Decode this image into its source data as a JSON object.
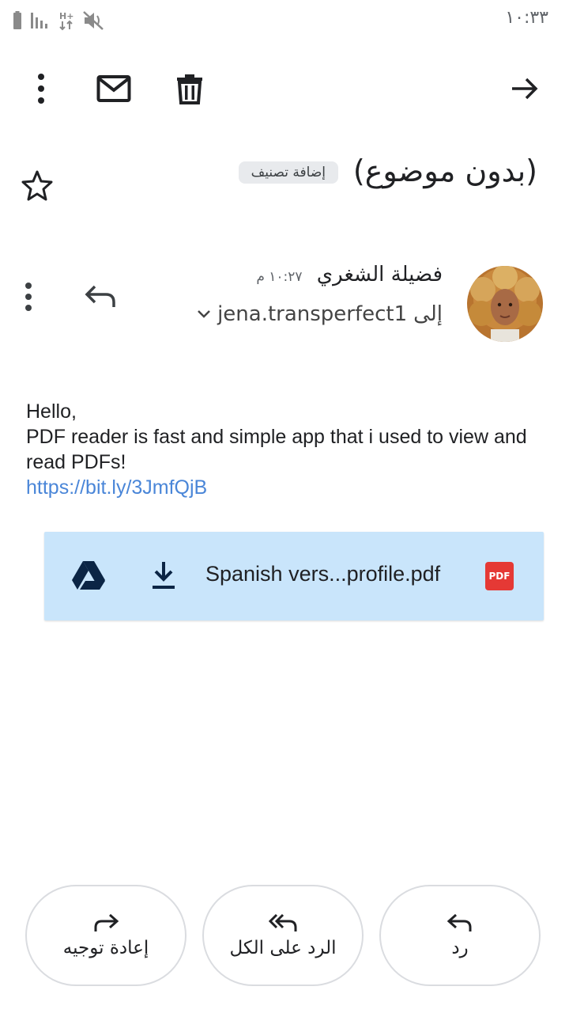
{
  "status_bar": {
    "time": "١٠:٣٣"
  },
  "toolbar": {
    "icons": [
      "more-vert-icon",
      "mail-icon",
      "delete-icon",
      "forward-arrow-icon"
    ]
  },
  "subject": {
    "text": "(بدون موضوع)",
    "label_chip": "إضافة تصنيف"
  },
  "sender": {
    "name": "فضيلة الشغري",
    "time": "١٠:٢٧ م",
    "recipient_prefix": "إلى",
    "recipient": "jena.transperfect1"
  },
  "message": {
    "line1": "Hello,",
    "line2": "PDF reader is fast and simple app that i used to view and read PDFs!",
    "link": "https://bit.ly/3JmfQjB"
  },
  "attachment": {
    "file_name": "Spanish vers...profile.pdf",
    "badge": "PDF",
    "badge_color": "#e53935",
    "background": "#c9e5fb"
  },
  "actions": {
    "forward": "إعادة توجيه",
    "reply_all": "الرد على الكل",
    "reply": "رد"
  }
}
